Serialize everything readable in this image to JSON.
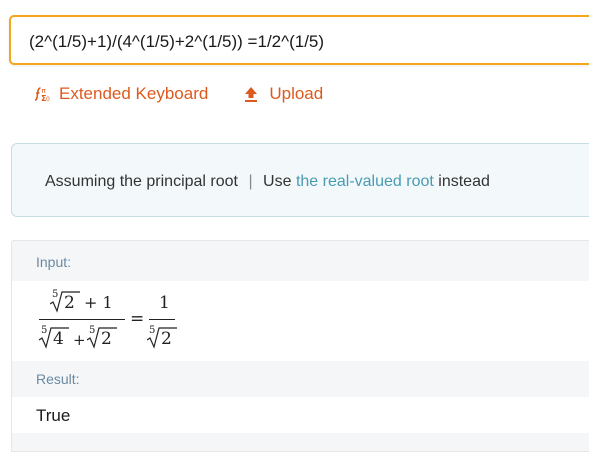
{
  "query": {
    "value": "(2^(1/5)+1)/(4^(1/5)+2^(1/5)) =1/2^(1/5)"
  },
  "toolbar": {
    "extended_keyboard_label": "Extended Keyboard",
    "upload_label": "Upload",
    "accent_color": "#dd5a1e"
  },
  "assumption": {
    "prefix": "Assuming the principal root",
    "separator": "|",
    "use_label": "Use",
    "link_text": "the real-valued root",
    "suffix": "instead"
  },
  "pods": {
    "input": {
      "title": "Input:",
      "expression": {
        "num_radicand": "2",
        "num_plus": "+ 1",
        "den_radicand_1": "4",
        "den_plus": "+",
        "den_radicand_2": "2",
        "equals": "=",
        "rhs_num": "1",
        "rhs_radicand": "2",
        "root_index": "5"
      }
    },
    "result": {
      "title": "Result:",
      "value": "True"
    }
  },
  "colors": {
    "input_border": "#f4a71d",
    "link": "#4a9bb2",
    "pod_title": "#6a8aa3"
  }
}
